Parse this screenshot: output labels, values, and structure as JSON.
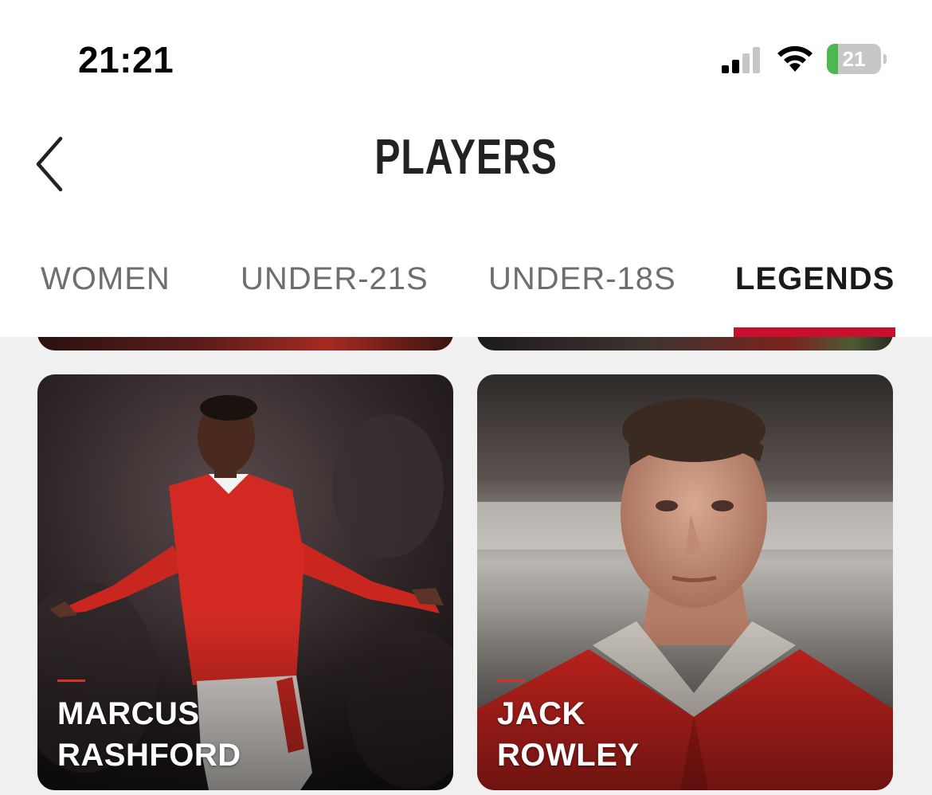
{
  "status_bar": {
    "time": "21:21",
    "battery_level": "21",
    "battery_percent": 21,
    "battery_color": "#4cb84f",
    "icons": [
      "signal-icon",
      "wifi-icon",
      "battery-icon"
    ]
  },
  "header": {
    "title": "PLAYERS",
    "back_icon": "chevron-left-icon"
  },
  "tabs": [
    {
      "label": "WOMEN",
      "active": false
    },
    {
      "label": "UNDER-21S",
      "active": false
    },
    {
      "label": "UNDER-18S",
      "active": false
    },
    {
      "label": "LEGENDS",
      "active": true
    }
  ],
  "accent_color": "#c8102e",
  "players": [
    {
      "first_name": "MARCUS",
      "last_name": "RASHFORD"
    },
    {
      "first_name": "JACK",
      "last_name": "ROWLEY"
    }
  ]
}
